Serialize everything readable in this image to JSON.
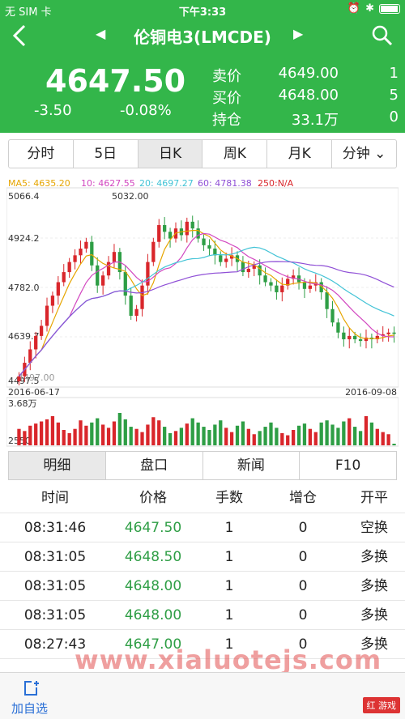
{
  "status": {
    "carrier": "无 SIM 卡",
    "time": "下午3:33"
  },
  "nav": {
    "title": "伦铜电3(LMCDE)"
  },
  "quote": {
    "price": "4647.50",
    "change": "-3.50",
    "change_pct": "-0.08%",
    "rows": [
      {
        "label": "卖价",
        "value": "4649.00",
        "qty": "1"
      },
      {
        "label": "买价",
        "value": "4648.00",
        "qty": "5"
      },
      {
        "label": "持仓",
        "value": "33.1万",
        "qty": "0"
      }
    ]
  },
  "period_tabs": [
    "分时",
    "5日",
    "日K",
    "周K",
    "月K",
    "分钟 ⌄"
  ],
  "period_active": 2,
  "legend": {
    "ma5": "MA5: 4635.20",
    "ma10": "10: 4627.55",
    "ma20": "20: 4697.27",
    "ma60": "60: 4781.38",
    "ma250": "250:N/A"
  },
  "chart_labels": {
    "y_top": "5066.4",
    "y2": "4924.2",
    "y3": "4782.0",
    "y4": "4639.7",
    "y_bottom": "4497.5",
    "high_mark": "5032.00",
    "low_mark": "4497.00",
    "date_start": "2016-06-17",
    "date_end": "2016-09-08",
    "vol_top": "3.68万",
    "vol_bottom": "2550"
  },
  "colors": {
    "up": "#d9262b",
    "down": "#2e9e45",
    "ma5": "#e6a500",
    "ma10": "#d247c0",
    "ma20": "#42c3d6",
    "ma60": "#8f4fd6",
    "brand": "#33b64a"
  },
  "chart_data": {
    "type": "candlestick",
    "x_range": [
      "2016-06-17",
      "2016-09-08"
    ],
    "ylim": [
      4497.5,
      5066.4
    ],
    "volume_range": [
      2550,
      36800
    ],
    "close": [
      4520,
      4560,
      4600,
      4640,
      4670,
      4730,
      4760,
      4800,
      4830,
      4860,
      4880,
      4900,
      4920,
      4850,
      4790,
      4820,
      4860,
      4890,
      4830,
      4760,
      4700,
      4720,
      4790,
      4860,
      4920,
      4970,
      4950,
      4930,
      4960,
      4940,
      4980,
      4960,
      4930,
      4910,
      4900,
      4880,
      4860,
      4870,
      4880,
      4860,
      4830,
      4840,
      4850,
      4820,
      4800,
      4790,
      4770,
      4790,
      4810,
      4820,
      4800,
      4780,
      4790,
      4800,
      4770,
      4720,
      4680,
      4650,
      4630,
      4640,
      4630,
      4625,
      4635,
      4630,
      4640,
      4645,
      4650,
      4647
    ],
    "volume": [
      18000,
      16000,
      21000,
      23000,
      25000,
      27000,
      30000,
      24000,
      17000,
      14000,
      18000,
      26000,
      21000,
      24000,
      28000,
      22000,
      19000,
      25000,
      33000,
      27000,
      20000,
      18000,
      15000,
      22000,
      29000,
      26000,
      20000,
      14000,
      16000,
      19000,
      23000,
      28000,
      24000,
      20000,
      17000,
      22000,
      26000,
      19000,
      15000,
      21000,
      25000,
      18000,
      13000,
      16000,
      20000,
      24000,
      19000,
      14000,
      12000,
      17000,
      21000,
      23000,
      18000,
      15000,
      24000,
      26000,
      22000,
      19000,
      25000,
      28000,
      20000,
      16000,
      30000,
      24000,
      18000,
      15000,
      13000,
      3000
    ]
  },
  "detail_tabs": [
    "明细",
    "盘口",
    "新闻",
    "F10"
  ],
  "detail_active": 0,
  "table": {
    "headers": [
      "时间",
      "价格",
      "手数",
      "增仓",
      "开平"
    ],
    "rows": [
      [
        "08:31:46",
        "4647.50",
        "1",
        "0",
        "空换"
      ],
      [
        "08:31:05",
        "4648.50",
        "1",
        "0",
        "多换"
      ],
      [
        "08:31:05",
        "4648.00",
        "1",
        "0",
        "多换"
      ],
      [
        "08:31:05",
        "4648.00",
        "1",
        "0",
        "多换"
      ],
      [
        "08:27:43",
        "4647.00",
        "1",
        "0",
        "多换"
      ]
    ]
  },
  "watermark": "www.xialuotejs.com",
  "bottom": {
    "fav_label": "加自选",
    "logo": "红 游戏"
  }
}
